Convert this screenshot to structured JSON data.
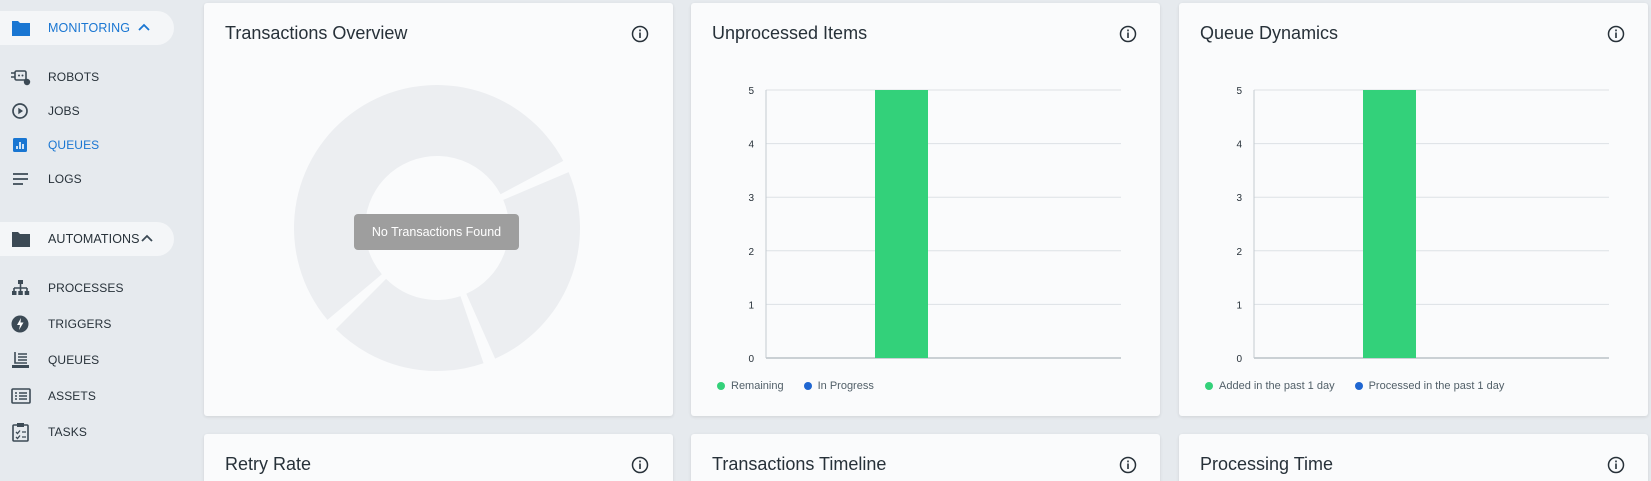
{
  "colors": {
    "accent": "#1976d2",
    "bar_green": "#33d17a",
    "in_progress_blue": "#1f66d1",
    "folder_dark": "#3c4a55"
  },
  "sidebar": {
    "monitoring": {
      "label": "MONITORING",
      "icon": "folder-icon",
      "expanded": true,
      "items": [
        {
          "label": "ROBOTS",
          "icon": "robot-icon"
        },
        {
          "label": "JOBS",
          "icon": "play-circle-icon"
        },
        {
          "label": "QUEUES",
          "icon": "bar-chart-icon",
          "active": true
        },
        {
          "label": "LOGS",
          "icon": "lines-icon"
        }
      ]
    },
    "automations": {
      "label": "AUTOMATIONS",
      "icon": "folder-icon",
      "expanded": true,
      "items": [
        {
          "label": "PROCESSES",
          "icon": "hierarchy-icon"
        },
        {
          "label": "TRIGGERS",
          "icon": "lightning-icon"
        },
        {
          "label": "QUEUES",
          "icon": "inbox-stack-icon"
        },
        {
          "label": "ASSETS",
          "icon": "asset-list-icon"
        },
        {
          "label": "TASKS",
          "icon": "clipboard-icon"
        }
      ]
    }
  },
  "cards": {
    "transactions_overview": {
      "title": "Transactions Overview",
      "empty_message": "No Transactions Found"
    },
    "unprocessed_items": {
      "title": "Unprocessed Items",
      "legend": [
        {
          "label": "Remaining",
          "color": "#33d17a"
        },
        {
          "label": "In Progress",
          "color": "#1f66d1"
        }
      ]
    },
    "queue_dynamics": {
      "title": "Queue Dynamics",
      "legend": [
        {
          "label": "Added in the past 1 day",
          "color": "#33d17a"
        },
        {
          "label": "Processed in the past 1 day",
          "color": "#1f66d1"
        }
      ]
    },
    "retry_rate": {
      "title": "Retry Rate"
    },
    "transactions_timeline": {
      "title": "Transactions Timeline"
    },
    "processing_time": {
      "title": "Processing Time"
    }
  },
  "chart_data": [
    {
      "chart": "Unprocessed Items",
      "type": "bar",
      "series": [
        {
          "name": "Remaining",
          "values": [
            5
          ]
        },
        {
          "name": "In Progress",
          "values": [
            0
          ]
        }
      ],
      "ylim": [
        0,
        5
      ],
      "yticks": [
        0,
        1,
        2,
        3,
        4,
        5
      ],
      "grid": true,
      "legend": "bottom-left"
    },
    {
      "chart": "Queue Dynamics",
      "type": "bar",
      "series": [
        {
          "name": "Added in the past 1 day",
          "values": [
            5
          ]
        },
        {
          "name": "Processed in the past 1 day",
          "values": [
            0
          ]
        }
      ],
      "ylim": [
        0,
        5
      ],
      "yticks": [
        0,
        1,
        2,
        3,
        4,
        5
      ],
      "grid": true,
      "legend": "bottom-left"
    }
  ]
}
